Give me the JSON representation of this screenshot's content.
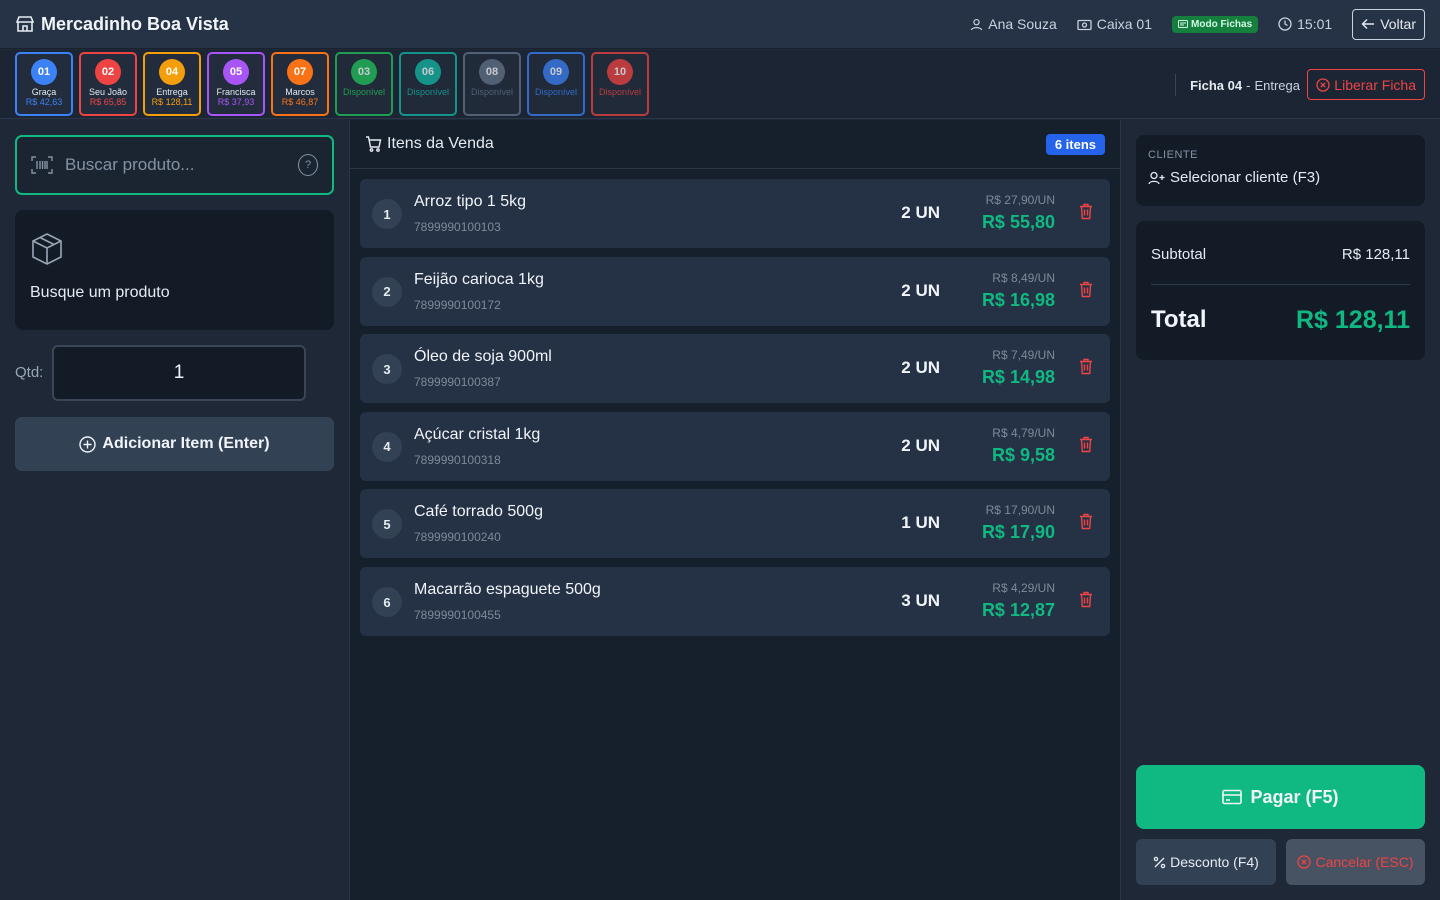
{
  "header": {
    "title": "Mercadinho Boa Vista",
    "user": "Ana Souza",
    "register": "Caixa 01",
    "mode": "Modo Fichas",
    "time": "15:01",
    "back_label": "Voltar"
  },
  "fichas": [
    {
      "num": "01",
      "name": "Graça",
      "value": "R$ 42,63",
      "color": "#3b82f6",
      "status": "occupied"
    },
    {
      "num": "02",
      "name": "Seu João",
      "value": "R$ 65,85",
      "color": "#ef4444",
      "status": "occupied"
    },
    {
      "num": "04",
      "name": "Entrega",
      "value": "R$ 128,11",
      "color": "#f59e0b",
      "status": "occupied"
    },
    {
      "num": "05",
      "name": "Francisca",
      "value": "R$ 37,93",
      "color": "#a855f7",
      "status": "occupied"
    },
    {
      "num": "07",
      "name": "Marcos",
      "value": "R$ 46,87",
      "color": "#f97316",
      "status": "occupied"
    },
    {
      "num": "03",
      "name": "Disponível",
      "value": "",
      "color": "#22c55e",
      "status": "free"
    },
    {
      "num": "06",
      "name": "Disponível",
      "value": "",
      "color": "#14b8a6",
      "status": "free"
    },
    {
      "num": "08",
      "name": "Disponível",
      "value": "",
      "color": "#64748b",
      "status": "free"
    },
    {
      "num": "09",
      "name": "Disponível",
      "value": "",
      "color": "#3b82f6",
      "status": "free"
    },
    {
      "num": "10",
      "name": "Disponível",
      "value": "",
      "color": "#ef4444",
      "status": "free"
    }
  ],
  "ficha_info": {
    "label": "Ficha 04",
    "sep": "-",
    "name": "Entrega"
  },
  "liberar_label": "Liberar Ficha",
  "search": {
    "placeholder": "Buscar produto...",
    "help": "?"
  },
  "product_box": {
    "label": "Busque um produto"
  },
  "qty": {
    "label": "Qtd:",
    "value": "1"
  },
  "add_button": "Adicionar Item (Enter)",
  "sale": {
    "title": "Itens da Venda",
    "count": "6 itens",
    "items": [
      {
        "idx": "1",
        "name": "Arroz tipo 1 5kg",
        "code": "7899990100103",
        "qty": "2 UN",
        "unit": "R$ 27,90/UN",
        "total": "R$ 55,80"
      },
      {
        "idx": "2",
        "name": "Feijão carioca 1kg",
        "code": "7899990100172",
        "qty": "2 UN",
        "unit": "R$ 8,49/UN",
        "total": "R$ 16,98"
      },
      {
        "idx": "3",
        "name": "Óleo de soja 900ml",
        "code": "7899990100387",
        "qty": "2 UN",
        "unit": "R$ 7,49/UN",
        "total": "R$ 14,98"
      },
      {
        "idx": "4",
        "name": "Açúcar cristal 1kg",
        "code": "7899990100318",
        "qty": "2 UN",
        "unit": "R$ 4,79/UN",
        "total": "R$ 9,58"
      },
      {
        "idx": "5",
        "name": "Café torrado 500g",
        "code": "7899990100240",
        "qty": "1 UN",
        "unit": "R$ 17,90/UN",
        "total": "R$ 17,90"
      },
      {
        "idx": "6",
        "name": "Macarrão espaguete 500g",
        "code": "7899990100455",
        "qty": "3 UN",
        "unit": "R$ 4,29/UN",
        "total": "R$ 12,87"
      }
    ]
  },
  "client": {
    "caption": "CLIENTE",
    "select_label": "Selecionar cliente (F3)"
  },
  "totals": {
    "subtotal_label": "Subtotal",
    "subtotal": "R$ 128,11",
    "total_label": "Total",
    "total": "R$ 128,11"
  },
  "actions": {
    "pay": "Pagar (F5)",
    "discount": "Desconto (F4)",
    "cancel": "Cancelar (ESC)"
  }
}
